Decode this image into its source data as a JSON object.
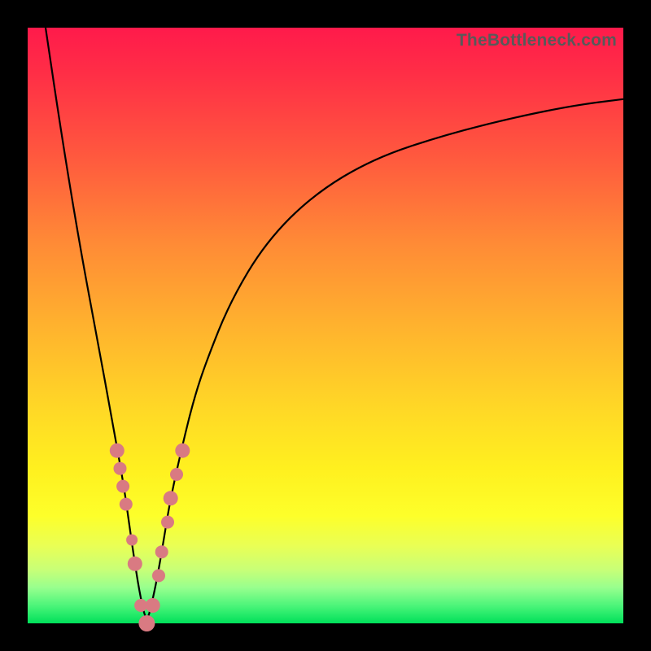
{
  "watermark": "TheBottleneck.com",
  "colors": {
    "frame": "#000000",
    "curve_stroke": "#000000",
    "marker_fill": "#d97a82",
    "gradient_stops": [
      "#ff1a4b",
      "#ff5a3e",
      "#ffb22e",
      "#fff01f",
      "#c8ff77",
      "#00e05a"
    ]
  },
  "chart_data": {
    "type": "line",
    "title": "",
    "xlabel": "",
    "ylabel": "",
    "xlim": [
      0,
      100
    ],
    "ylim": [
      0,
      100
    ],
    "grid": false,
    "legend": false,
    "series": [
      {
        "name": "bottleneck-curve",
        "x": [
          3,
          6,
          9,
          12,
          14,
          16,
          17,
          18,
          19,
          20,
          21,
          22,
          23,
          24,
          26,
          28,
          30,
          34,
          40,
          48,
          58,
          70,
          82,
          92,
          100
        ],
        "y": [
          100,
          80,
          62,
          46,
          35,
          24,
          17,
          10,
          4,
          0,
          4,
          9,
          15,
          21,
          30,
          38,
          44,
          54,
          64,
          72,
          78,
          82,
          85,
          87,
          88
        ]
      }
    ],
    "markers": {
      "name": "highlight-points",
      "x": [
        15.0,
        15.5,
        16.0,
        16.5,
        17.5,
        18.0,
        19.0,
        20.0,
        21.0,
        22.0,
        22.5,
        23.5,
        24.0,
        25.0,
        26.0
      ],
      "y": [
        29,
        26,
        23,
        20,
        14,
        10,
        3,
        0,
        3,
        8,
        12,
        17,
        21,
        25,
        29
      ],
      "r": [
        9,
        8,
        8,
        8,
        7,
        9,
        8,
        10,
        9,
        8,
        8,
        8,
        9,
        8,
        9
      ]
    }
  }
}
